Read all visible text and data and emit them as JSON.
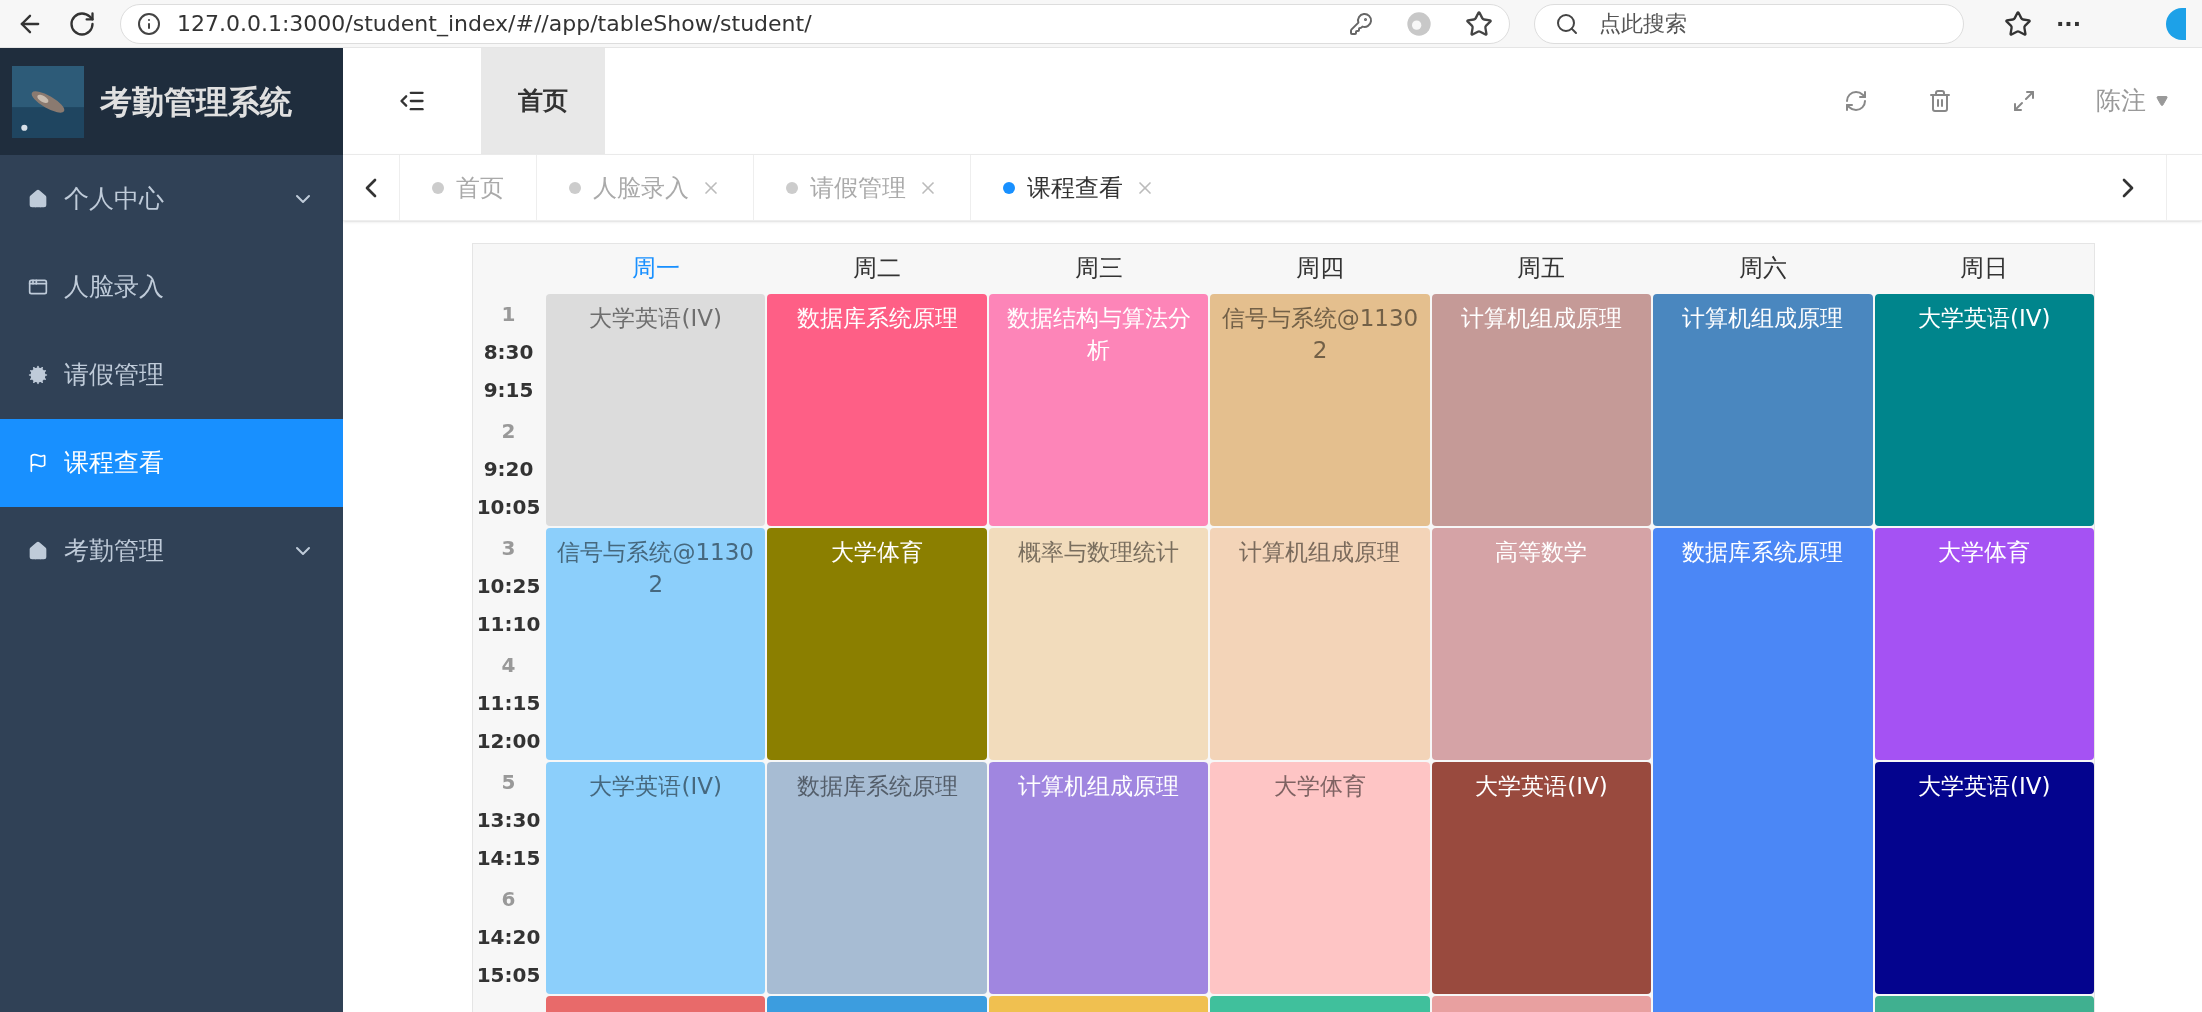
{
  "browser": {
    "url": "127.0.0.1:3000/student_index/#//app/tableShow/student/",
    "search": {
      "placeholder": "点此搜索"
    },
    "more": "···"
  },
  "sidebar": {
    "title": "考勤管理系统",
    "items": [
      {
        "label": "个人中心",
        "has_submenu": true,
        "selected": false
      },
      {
        "label": "人脸录入",
        "has_submenu": false,
        "selected": false
      },
      {
        "label": "请假管理",
        "has_submenu": false,
        "selected": false
      },
      {
        "label": "课程查看",
        "has_submenu": false,
        "selected": true
      },
      {
        "label": "考勤管理",
        "has_submenu": true,
        "selected": false
      }
    ]
  },
  "header": {
    "nav_tab": "首页",
    "user": "陈注"
  },
  "tabs": [
    {
      "label": "首页",
      "closable": false,
      "selected": false
    },
    {
      "label": "人脸录入",
      "closable": true,
      "selected": false
    },
    {
      "label": "请假管理",
      "closable": true,
      "selected": false
    },
    {
      "label": "课程查看",
      "closable": true,
      "selected": true
    }
  ],
  "timetable": {
    "days": [
      {
        "label": "周一",
        "selected": true
      },
      {
        "label": "周二",
        "selected": false
      },
      {
        "label": "周三",
        "selected": false
      },
      {
        "label": "周四",
        "selected": false
      },
      {
        "label": "周五",
        "selected": false
      },
      {
        "label": "周六",
        "selected": false
      },
      {
        "label": "周日",
        "selected": false
      }
    ],
    "periods": [
      {
        "number": "1",
        "start": "8:30",
        "end": "9:15"
      },
      {
        "number": "2",
        "start": "9:20",
        "end": "10:05"
      },
      {
        "number": "3",
        "start": "10:25",
        "end": "11:10"
      },
      {
        "number": "4",
        "start": "11:15",
        "end": "12:00"
      },
      {
        "number": "5",
        "start": "13:30",
        "end": "14:15"
      },
      {
        "number": "6",
        "start": "14:20",
        "end": "15:05"
      }
    ],
    "courses": [
      {
        "name": "大学英语(IV)",
        "color": "#dcdcdc"
      },
      {
        "name": "数据库系统原理",
        "color": "#fe5f86"
      },
      {
        "name": "数据结构与算法分析",
        "color": "#fd85b8"
      },
      {
        "name": "信号与系统@11302",
        "color": "#e4bf8e"
      },
      {
        "name": "计算机组成原理",
        "color": "#c59a97"
      },
      {
        "name": "计算机组成原理",
        "color": "#4a87bf"
      },
      {
        "name": "大学英语(IV)",
        "color": "#00858c"
      },
      {
        "name": "信号与系统@11302",
        "color": "#8ccffb"
      },
      {
        "name": "大学体育",
        "color": "#8b7f00"
      },
      {
        "name": "概率与数理统计",
        "color": "#f2dcbc"
      },
      {
        "name": "计算机组成原理",
        "color": "#f3d4b8"
      },
      {
        "name": "高等数学",
        "color": "#d5a3a6"
      },
      {
        "name": "数据库系统原理",
        "color": "#4b87f6"
      },
      {
        "name": "大学体育",
        "color": "#a552f3"
      },
      {
        "name": "大学英语(IV)",
        "color": "#8ccffb"
      },
      {
        "name": "数据库系统原理",
        "color": "#a7bcd3"
      },
      {
        "name": "计算机组成原理",
        "color": "#a086e0"
      },
      {
        "name": "大学体育",
        "color": "#fec5c5"
      },
      {
        "name": "大学英语(IV)",
        "color": "#994a3e"
      },
      {
        "name": "大学英语(IV)",
        "color": "#04048e"
      },
      {
        "color": "#e86a6a"
      },
      {
        "color": "#3c9ddf"
      },
      {
        "color": "#f0c050"
      },
      {
        "color": "#40c09c"
      },
      {
        "color": "#e8a0a0"
      },
      {
        "color": "#40b090"
      }
    ]
  }
}
